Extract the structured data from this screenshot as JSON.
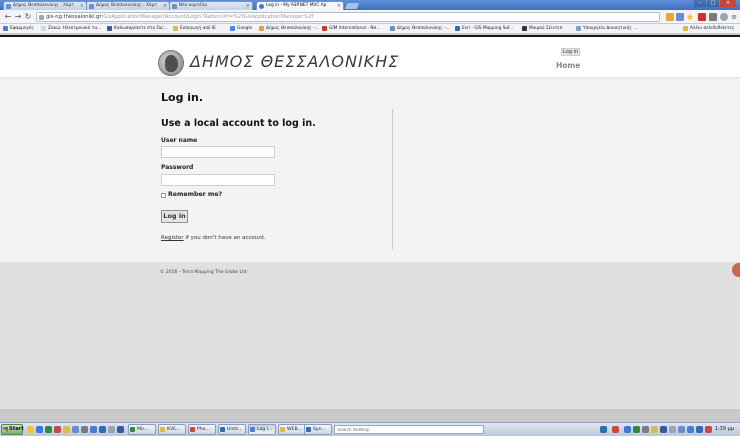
{
  "browser": {
    "tabs": [
      {
        "label": "Δήμος Θεσσαλονίκης - Χάρτ",
        "icon": "page-icon"
      },
      {
        "label": "Δήμος Θεσσαλονίκης - Χάρτ",
        "icon": "page-icon"
      },
      {
        "label": "Νέα καρτέλα",
        "icon": "page-icon"
      },
      {
        "label": "Log in - My ASP.NET MVC Ap",
        "icon": "ie-icon"
      }
    ],
    "active_tab": 3,
    "address": {
      "host": "gis-ng.thessaloniki.gr",
      "path": "/GisApplicationManager/Account/Login?ReturnUrl=%2fGisApplicationManager%2f"
    },
    "bookmarks": [
      {
        "label": "Εφαρμογές",
        "color": "#4b7cd3"
      },
      {
        "label": "Ζακώ: Ηλεκτρονικό τα...",
        "color": "#e8e8e8"
      },
      {
        "label": "Καλωσορίσατε στο Fac...",
        "color": "#3b5998"
      },
      {
        "label": "Εισαγωγή από IE",
        "color": "#e0b84c"
      },
      {
        "label": "Google",
        "color": "#4285f4"
      },
      {
        "label": "Δήμος Θεσσαλονίκης -...",
        "color": "#e89a3a"
      },
      {
        "label": "GIM International - Ne...",
        "color": "#c23b2b"
      },
      {
        "label": "Δήμος Θεσσαλονίκης -...",
        "color": "#6a8fc7"
      },
      {
        "label": "Esri - GIS Mapping Sof...",
        "color": "#2f6fb0"
      },
      {
        "label": "Μικρού Σέιντεσ",
        "color": "#333333"
      },
      {
        "label": "Υπουργείο Διοικητικής ...",
        "color": "#7aa0d6"
      },
      {
        "label": "Άλλοι σελιδοδείκτες",
        "color": "#e0b84c"
      }
    ]
  },
  "site": {
    "title": "ΔΗΜΟΣ ΘΕΣΣΑΛΟΝΙΚΗΣ",
    "login_link": "Log in",
    "home_link": "Home"
  },
  "form": {
    "heading": "Log in.",
    "subheading": "Use a local account to log in.",
    "username_label": "User name",
    "username_value": "",
    "password_label": "Password",
    "password_value": "",
    "remember_label": "Remember me?",
    "submit_label": "Log in",
    "register_link": "Register",
    "register_text": " if you don't have an account."
  },
  "footer": {
    "copyright": "© 2016 - Terra Mapping The Globe Ltd"
  },
  "taskbar": {
    "start_label": "Start",
    "buttons": [
      {
        "label": "Mic...",
        "color": "#2f8a3e"
      },
      {
        "label": "KVE...",
        "color": "#e0b84c"
      },
      {
        "label": "Pho...",
        "color": "#c84a3a"
      },
      {
        "label": "Untit...",
        "color": "#2f6fb0"
      },
      {
        "label": "Log i...",
        "color": "#4b7cd3"
      },
      {
        "label": "WEB...",
        "color": "#e0b84c"
      },
      {
        "label": "Syn...",
        "color": "#2f6fb0"
      }
    ],
    "active_button": 4,
    "search_placeholder": "Search Desktop",
    "clock": "1:39 μμ"
  }
}
